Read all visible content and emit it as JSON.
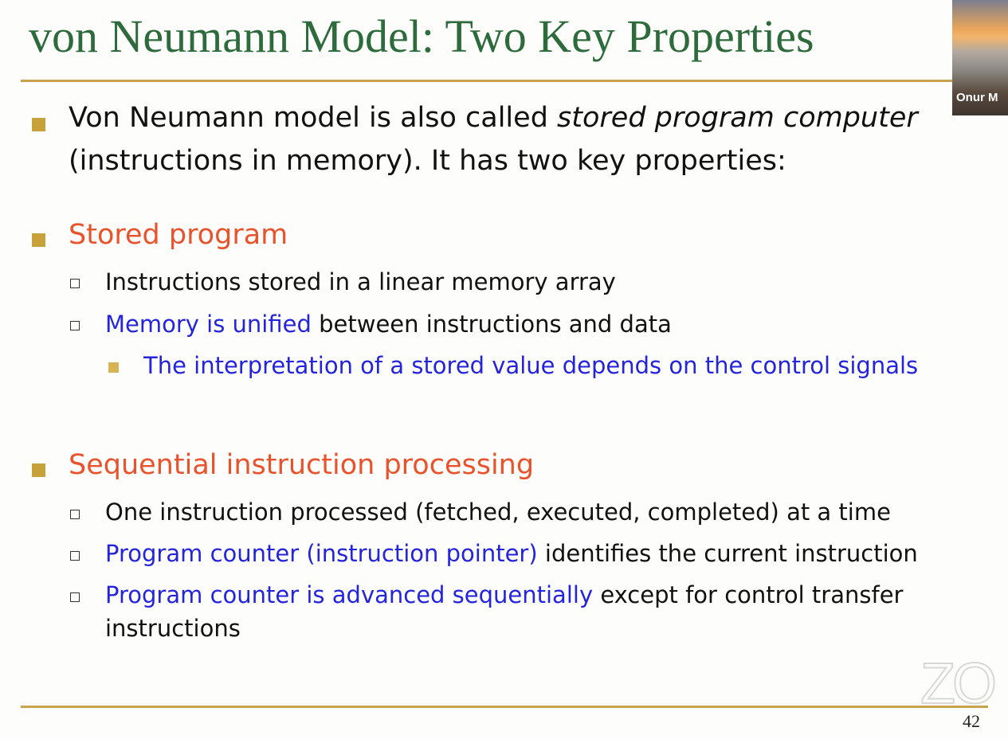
{
  "slide": {
    "title": "von Neumann Model: Two Key Properties",
    "intro": {
      "line1_plain": "Von Neumann model is also called ",
      "line1_italic": "stored program computer",
      "line2": "(instructions in memory). It has two key properties:"
    },
    "sections": [
      {
        "heading": "Stored program",
        "items": [
          {
            "highlight": "",
            "text": "Instructions stored in a linear memory array"
          },
          {
            "highlight": "Memory is unified",
            "text": " between instructions and data"
          }
        ],
        "subitem": "The interpretation of a stored value depends on the control signals"
      },
      {
        "heading": "Sequential instruction processing",
        "items": [
          {
            "highlight": "",
            "text": "One instruction processed (fetched, executed, completed) at a time"
          },
          {
            "highlight": "Program counter (instruction pointer)",
            "text": " identifies the current instruction"
          },
          {
            "highlight": "Program counter is advanced sequentially",
            "text": " except for control transfer",
            "continuation": "instructions"
          }
        ]
      }
    ],
    "page_number": "42"
  },
  "overlay": {
    "webcam_name": "Onur M",
    "watermark": "ZO"
  },
  "colors": {
    "title": "#2d6a3c",
    "heading": "#e9532c",
    "highlight": "#2424dd",
    "rule": "#c9a24c"
  }
}
